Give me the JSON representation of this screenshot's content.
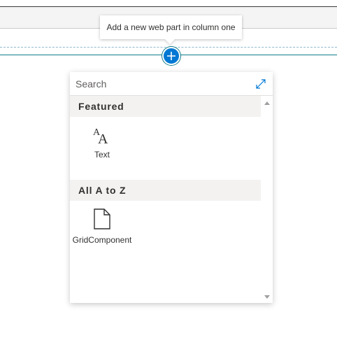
{
  "tooltip": {
    "text": "Add a new web part in column one"
  },
  "add_button": {
    "icon": "plus-icon",
    "color": "#0078d4"
  },
  "toolbox": {
    "search": {
      "placeholder": "Search",
      "value": ""
    },
    "expand_icon": "expand-icon",
    "sections": [
      {
        "title": "Featured",
        "items": [
          {
            "label": "Text",
            "icon": "text-icon"
          }
        ]
      },
      {
        "title": "All A to Z",
        "items": [
          {
            "label": "GridComponent",
            "icon": "document-icon"
          }
        ]
      }
    ]
  },
  "colors": {
    "accent": "#0078d4",
    "section_bg": "#f3f2f1",
    "divider_teal": "#0f7b8a"
  }
}
